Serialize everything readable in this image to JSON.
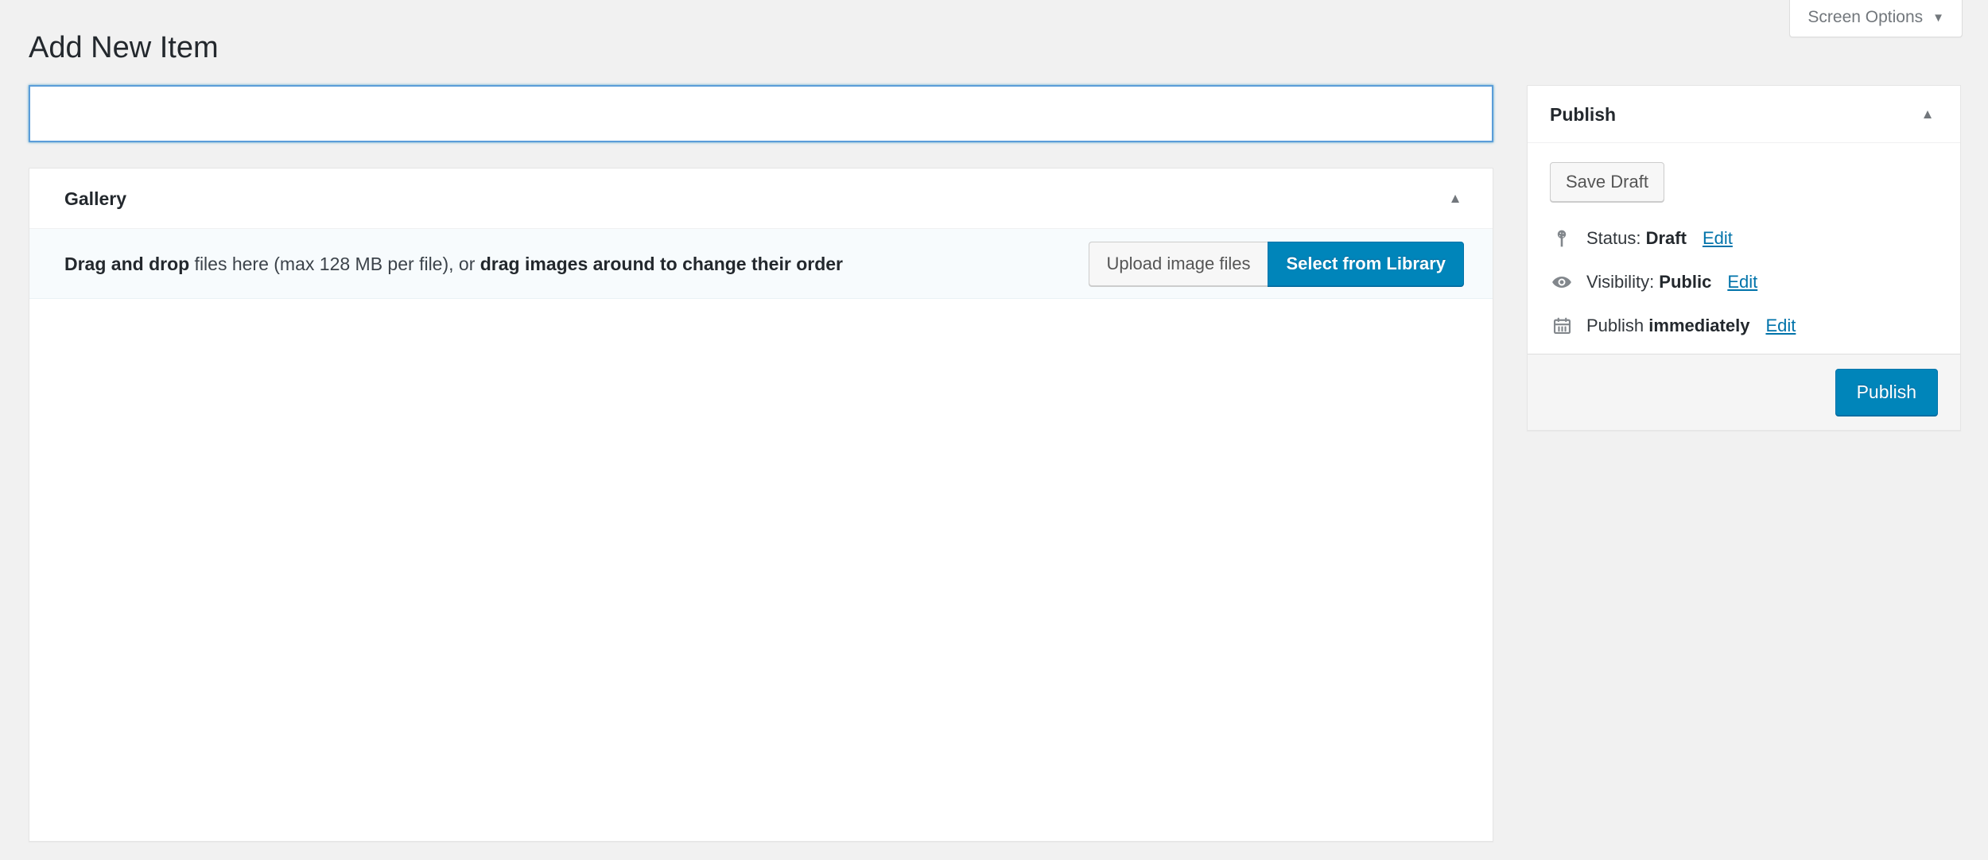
{
  "screen_meta": {
    "options_label": "Screen Options",
    "caret": "▼"
  },
  "page": {
    "title": "Add New Item"
  },
  "title_field": {
    "value": "",
    "placeholder": ""
  },
  "gallery": {
    "heading": "Gallery",
    "toggle_glyph": "▲",
    "dropzone": {
      "lead": "Drag and drop",
      "middle": " files here (max 128 MB per file), or ",
      "emphasis": "drag images around to change their order",
      "full_text": "Drag and drop files here (max 128 MB per file), or drag images around to change their order"
    },
    "upload_button": "Upload image files",
    "library_button": "Select from Library"
  },
  "publish": {
    "heading": "Publish",
    "toggle_glyph": "▲",
    "save_draft_label": "Save Draft",
    "rows": [
      {
        "icon": "post-status-pin-icon",
        "label": "Status: ",
        "value": "Draft",
        "edit": "Edit"
      },
      {
        "icon": "eye-icon",
        "label": "Visibility: ",
        "value": "Public",
        "edit": "Edit"
      },
      {
        "icon": "calendar-icon",
        "label": "Publish ",
        "value": "immediately",
        "edit": "Edit"
      }
    ],
    "publish_button": "Publish"
  },
  "colors": {
    "accent_blue": "#0085ba",
    "accent_blue_border": "#0073aa",
    "link_blue": "#0073aa",
    "focus_blue": "#5b9dd9",
    "page_bg": "#f1f1f1",
    "panel_bg": "#ffffff",
    "dropzone_bg": "#f7fbfd",
    "footer_bg": "#f5f5f5"
  }
}
